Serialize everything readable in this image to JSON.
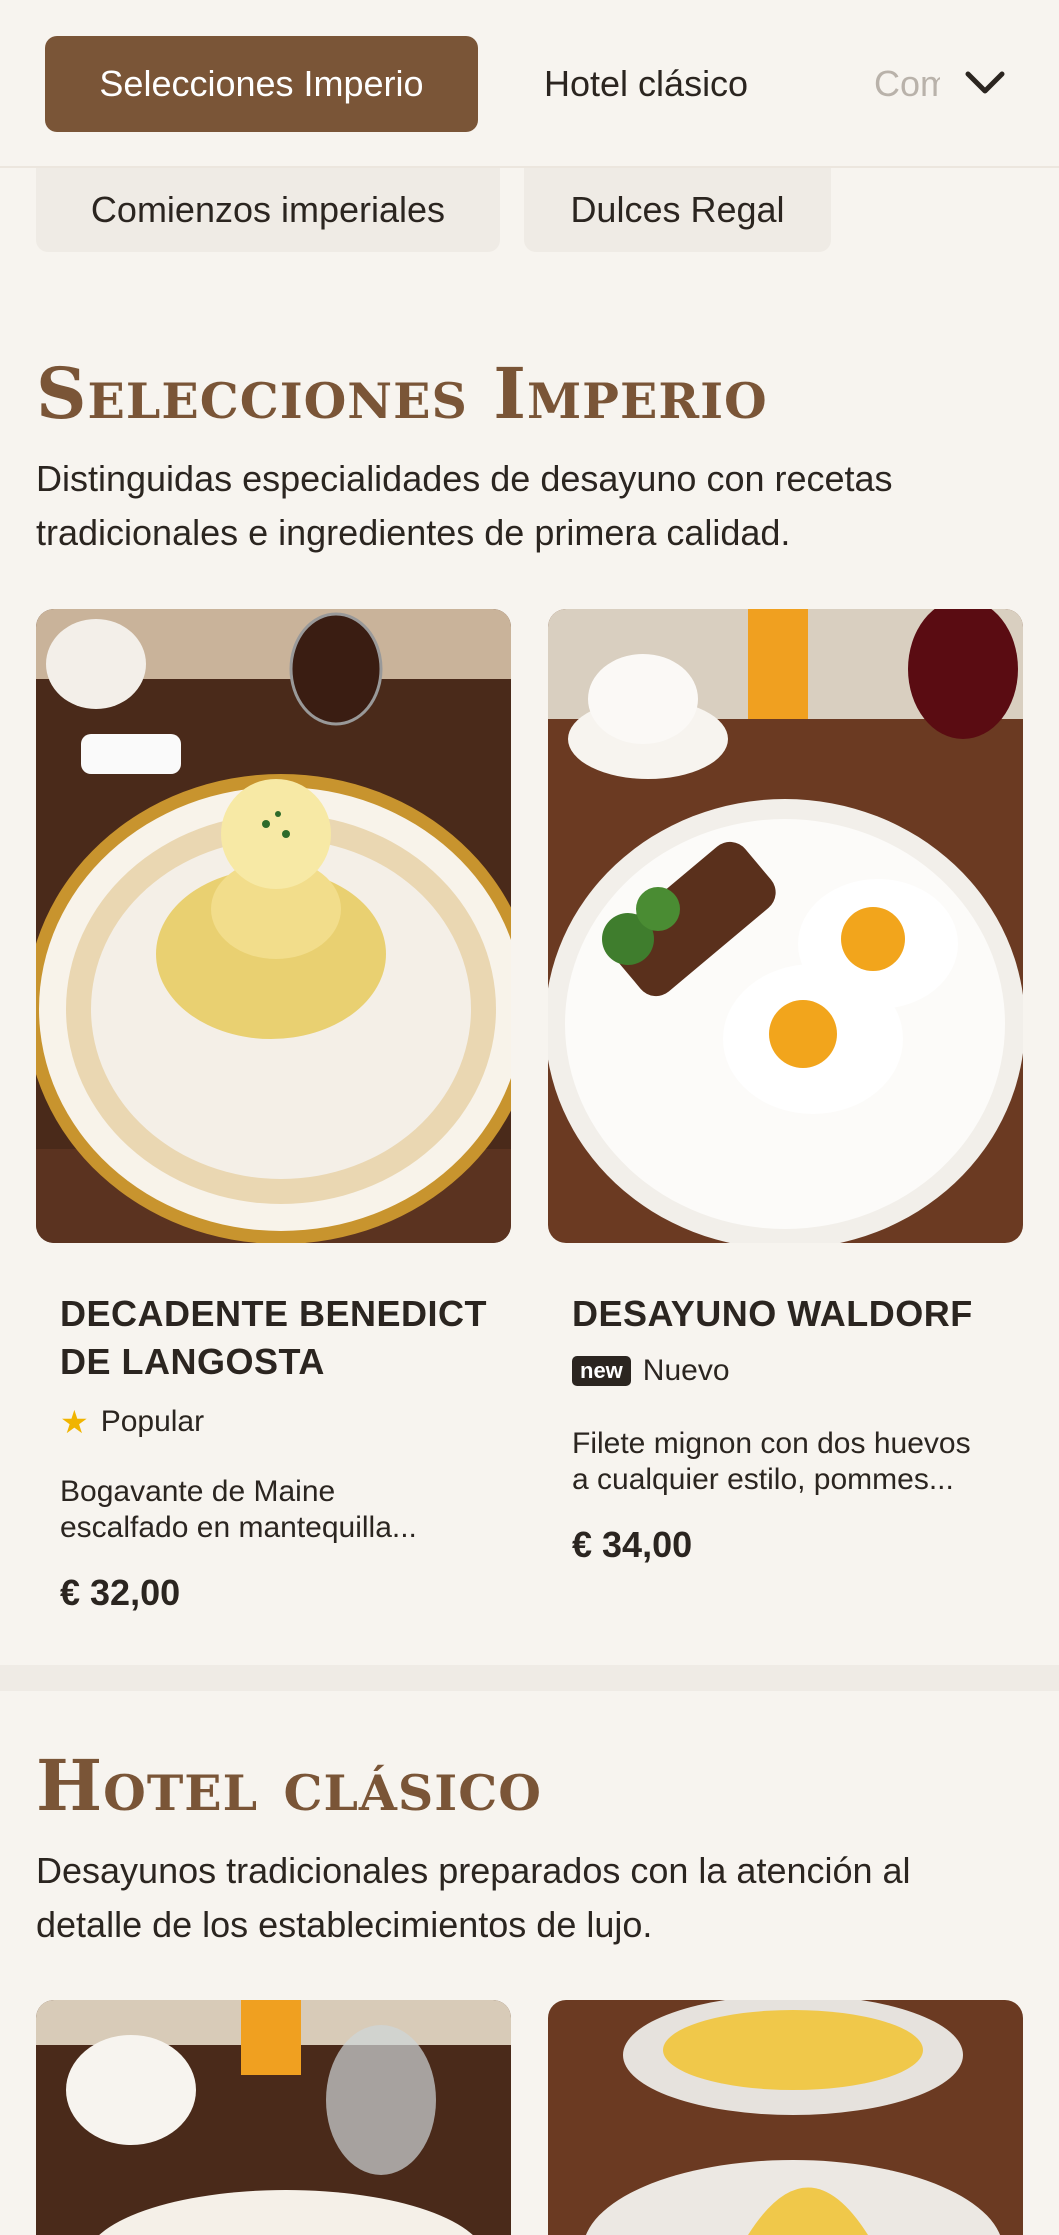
{
  "tabs": {
    "active": "Selecciones Imperio",
    "second": "Hotel clásico",
    "third_partial": "Comienzos imperiales"
  },
  "chips": [
    "Comienzos imperiales",
    "Dulces Regal"
  ],
  "sections": [
    {
      "title": "Selecciones Imperio",
      "description": "Distinguidas especialidades de desayuno con recetas tradicionales e ingredientes de primera calidad.",
      "items": [
        {
          "name_line1": "DECADENTE BENEDICT",
          "name_line2": "DE LANGOSTA",
          "badge_icon": "star-icon",
          "badge_label": "Popular",
          "desc_line1": "Bogavante de Maine",
          "desc_line2": "escalfado en mantequilla...",
          "price": "€ 32,00"
        },
        {
          "name_line1": "DESAYUNO WALDORF",
          "badge_tag": "new",
          "badge_label": "Nuevo",
          "desc_line1": "Filete mignon con dos huevos",
          "desc_line2": "a cualquier estilo, pommes...",
          "price": "€ 34,00"
        }
      ]
    },
    {
      "title": "Hotel clásico",
      "description": "Desayunos tradicionales preparados con la atención al detalle de los establecimientos de lujo."
    }
  ],
  "colors": {
    "accent": "#7a5537",
    "background": "#f7f4ef",
    "chip": "#efebe5",
    "star": "#f0b400"
  }
}
